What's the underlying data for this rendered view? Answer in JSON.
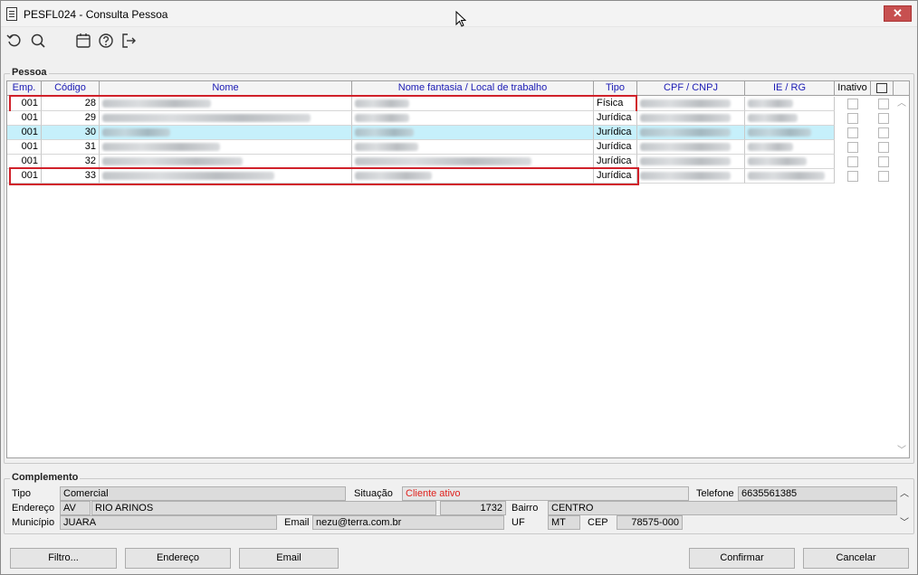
{
  "window": {
    "title": "PESFL024 - Consulta Pessoa",
    "close": "✕"
  },
  "toolbar": {
    "icons": [
      "refresh-icon",
      "search-icon",
      "calendar-icon",
      "help-icon",
      "exit-icon"
    ]
  },
  "pessoa": {
    "label": "Pessoa",
    "columns": [
      "Emp.",
      "Código",
      "Nome",
      "Nome fantasia / Local de trabalho",
      "Tipo",
      "CPF / CNPJ",
      "IE / RG",
      "Inativo"
    ],
    "rows": [
      {
        "emp": "001",
        "codigo": "28",
        "tipo": "Física",
        "selected": false,
        "highlighted": true
      },
      {
        "emp": "001",
        "codigo": "29",
        "tipo": "Jurídica",
        "selected": false,
        "highlighted": false
      },
      {
        "emp": "001",
        "codigo": "30",
        "tipo": "Jurídica",
        "selected": true,
        "highlighted": false
      },
      {
        "emp": "001",
        "codigo": "31",
        "tipo": "Jurídica",
        "selected": false,
        "highlighted": false
      },
      {
        "emp": "001",
        "codigo": "32",
        "tipo": "Jurídica",
        "selected": false,
        "highlighted": false
      },
      {
        "emp": "001",
        "codigo": "33",
        "tipo": "Jurídica",
        "selected": false,
        "highlighted": true
      }
    ]
  },
  "complemento": {
    "label": "Complemento",
    "tipo_label": "Tipo",
    "tipo_value": "Comercial",
    "situacao_label": "Situação",
    "situacao_value": "Cliente ativo",
    "telefone_label": "Telefone",
    "telefone_value": "6635561385",
    "endereco_label": "Endereço",
    "endereco_tipo": "AV",
    "endereco_logradouro": "RIO ARINOS",
    "endereco_numero": "1732",
    "bairro_label": "Bairro",
    "bairro_value": "CENTRO",
    "municipio_label": "Município",
    "municipio_value": "JUARA",
    "email_label": "Email",
    "email_value": "nezu@terra.com.br",
    "uf_label": "UF",
    "uf_value": "MT",
    "cep_label": "CEP",
    "cep_value": "78575-000"
  },
  "buttons": {
    "filtro": "Filtro...",
    "endereco": "Endereço",
    "email": "Email",
    "confirmar": "Confirmar",
    "cancelar": "Cancelar"
  },
  "colors": {
    "selected_row": "#c6f0fb",
    "highlight": "#d0212a",
    "header_text": "#1a1ab4",
    "status_active": "#e0211d"
  }
}
